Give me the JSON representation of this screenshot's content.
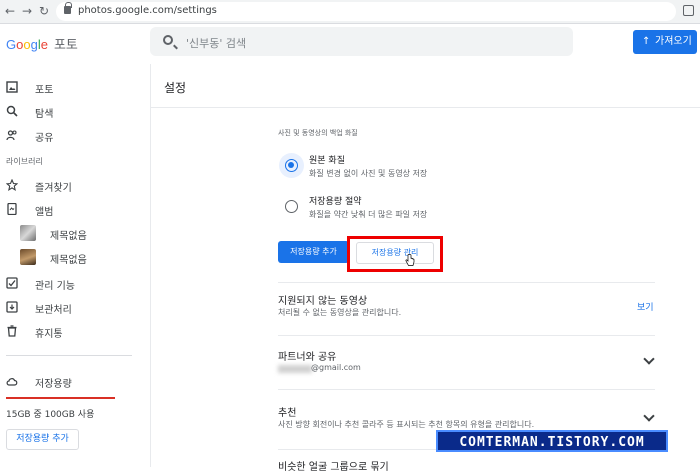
{
  "browser": {
    "url": "photos.google.com/settings"
  },
  "header": {
    "logo_letters": [
      "G",
      "o",
      "o",
      "g",
      "l",
      "e"
    ],
    "product": "포토",
    "search_placeholder": "'신부동' 검색",
    "upload_label": "가져오기"
  },
  "sidebar": {
    "items": [
      {
        "label": "포토",
        "icon": "photo-icon"
      },
      {
        "label": "탐색",
        "icon": "search-icon"
      },
      {
        "label": "공유",
        "icon": "people-icon"
      }
    ],
    "library_label": "라이브러리",
    "library_items": [
      {
        "label": "즐겨찾기",
        "icon": "star-icon"
      },
      {
        "label": "앨범",
        "icon": "album-icon"
      }
    ],
    "albums": [
      {
        "label": "제목없음"
      },
      {
        "label": "제목없음"
      }
    ],
    "more_items": [
      {
        "label": "관리 기능",
        "icon": "utilities-icon"
      },
      {
        "label": "보관처리",
        "icon": "archive-icon"
      },
      {
        "label": "휴지통",
        "icon": "trash-icon"
      }
    ],
    "storage_label": "저장용량",
    "storage_usage": "15GB 중 100GB 사용",
    "buy_storage": "저장용량 추가"
  },
  "main": {
    "title": "설정",
    "backup_section": "사진 및 동영상의 백업 화질",
    "options": [
      {
        "title": "원본 화질",
        "desc": "화질 변경 없이 사진 및 동영상 저장",
        "selected": true
      },
      {
        "title": "저장용량 절약",
        "desc": "화질을 약간 낮춰 더 많은 파일 저장",
        "selected": false
      }
    ],
    "btn_buy": "저장용량 추가",
    "btn_manage": "저장용량 관리",
    "unsupported_title": "지원되지 않는 동영상",
    "unsupported_desc": "처리될 수 없는 동영상을 관리합니다.",
    "view_link": "보기",
    "partner_title": "파트너와 공유",
    "partner_email": "@gmail.com",
    "suggest_title": "추천",
    "suggest_desc": "사진 방향 회전이나 추천 콜라주 등 표시되는 추천 항목의 유형을 관리합니다.",
    "next_title": "비슷한 얼굴 그룹으로 묶기"
  },
  "watermark": "COMTERMAN.TISTORY.COM",
  "colors": {
    "accent": "#1a73e8",
    "highlight": "#ee0000",
    "storage_bar": "#d93025"
  }
}
